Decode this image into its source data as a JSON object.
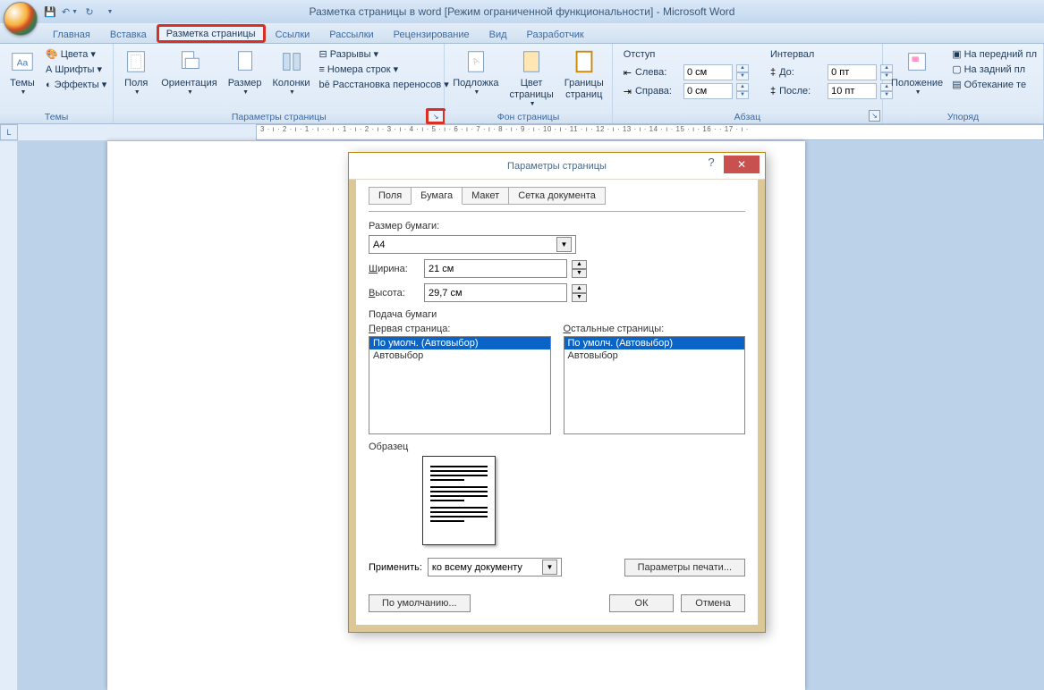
{
  "title": "Разметка страницы в word [Режим ограниченной функциональности] - Microsoft Word",
  "tabs": {
    "home": "Главная",
    "insert": "Вставка",
    "layout": "Разметка страницы",
    "refs": "Ссылки",
    "mail": "Рассылки",
    "review": "Рецензирование",
    "view": "Вид",
    "dev": "Разработчик"
  },
  "themes": {
    "label": "Темы",
    "btn": "Темы",
    "colors": "Цвета ▾",
    "fonts": "Шрифты ▾",
    "effects": "Эффекты ▾"
  },
  "page_setup": {
    "label": "Параметры страницы",
    "margins": "Поля",
    "orient": "Ориентация",
    "size": "Размер",
    "cols": "Колонки",
    "breaks": "Разрывы ▾",
    "lines": "Номера строк ▾",
    "hyph": "Расстановка переносов ▾"
  },
  "page_bg": {
    "label": "Фон страницы",
    "watermark": "Подложка",
    "color": "Цвет\nстраницы",
    "borders": "Границы\nстраниц"
  },
  "paragraph": {
    "label": "Абзац",
    "indent_head": "Отступ",
    "spacing_head": "Интервал",
    "left": "Слева:",
    "right": "Справа:",
    "before": "До:",
    "after": "После:",
    "left_v": "0 см",
    "right_v": "0 см",
    "before_v": "0 пт",
    "after_v": "10 пт"
  },
  "arrange": {
    "label": "Упоряд",
    "position": "Положение",
    "front": "На передний пл",
    "back": "На задний пл",
    "wrap": "Обтекание те"
  },
  "ruler_text": "3 · ı · 2 · ı · 1 · ı ·   · ı · 1 · ı · 2 · ı · 3 · ı · 4 · ı · 5 · ı · 6 · ı · 7 · ı · 8 · ı · 9 · ı · 10 · ı · 11 · ı · 12 · ı · 13 · ı · 14 · ı · 15 · ı · 16 ·   · 17 · ı ·",
  "dialog": {
    "title": "Параметры страницы",
    "tabs": {
      "fields": "Поля",
      "paper": "Бумага",
      "layout": "Макет",
      "grid": "Сетка документа"
    },
    "paper_size_lbl": "Размер бумаги:",
    "paper_size": "A4",
    "width_lbl": "Ширина:",
    "width": "21 см",
    "height_lbl": "Высота:",
    "height": "29,7 см",
    "feed_head": "Подача бумаги",
    "first_page": "Первая страница:",
    "other_pages": "Остальные страницы:",
    "opt_default": "По умолч. (Автовыбор)",
    "opt_auto": "Автовыбор",
    "sample": "Образец",
    "apply_lbl": "Применить:",
    "apply_val": "ко всему документу",
    "print_opts": "Параметры печати...",
    "default_btn": "По умолчанию...",
    "ok": "ОК",
    "cancel": "Отмена"
  }
}
